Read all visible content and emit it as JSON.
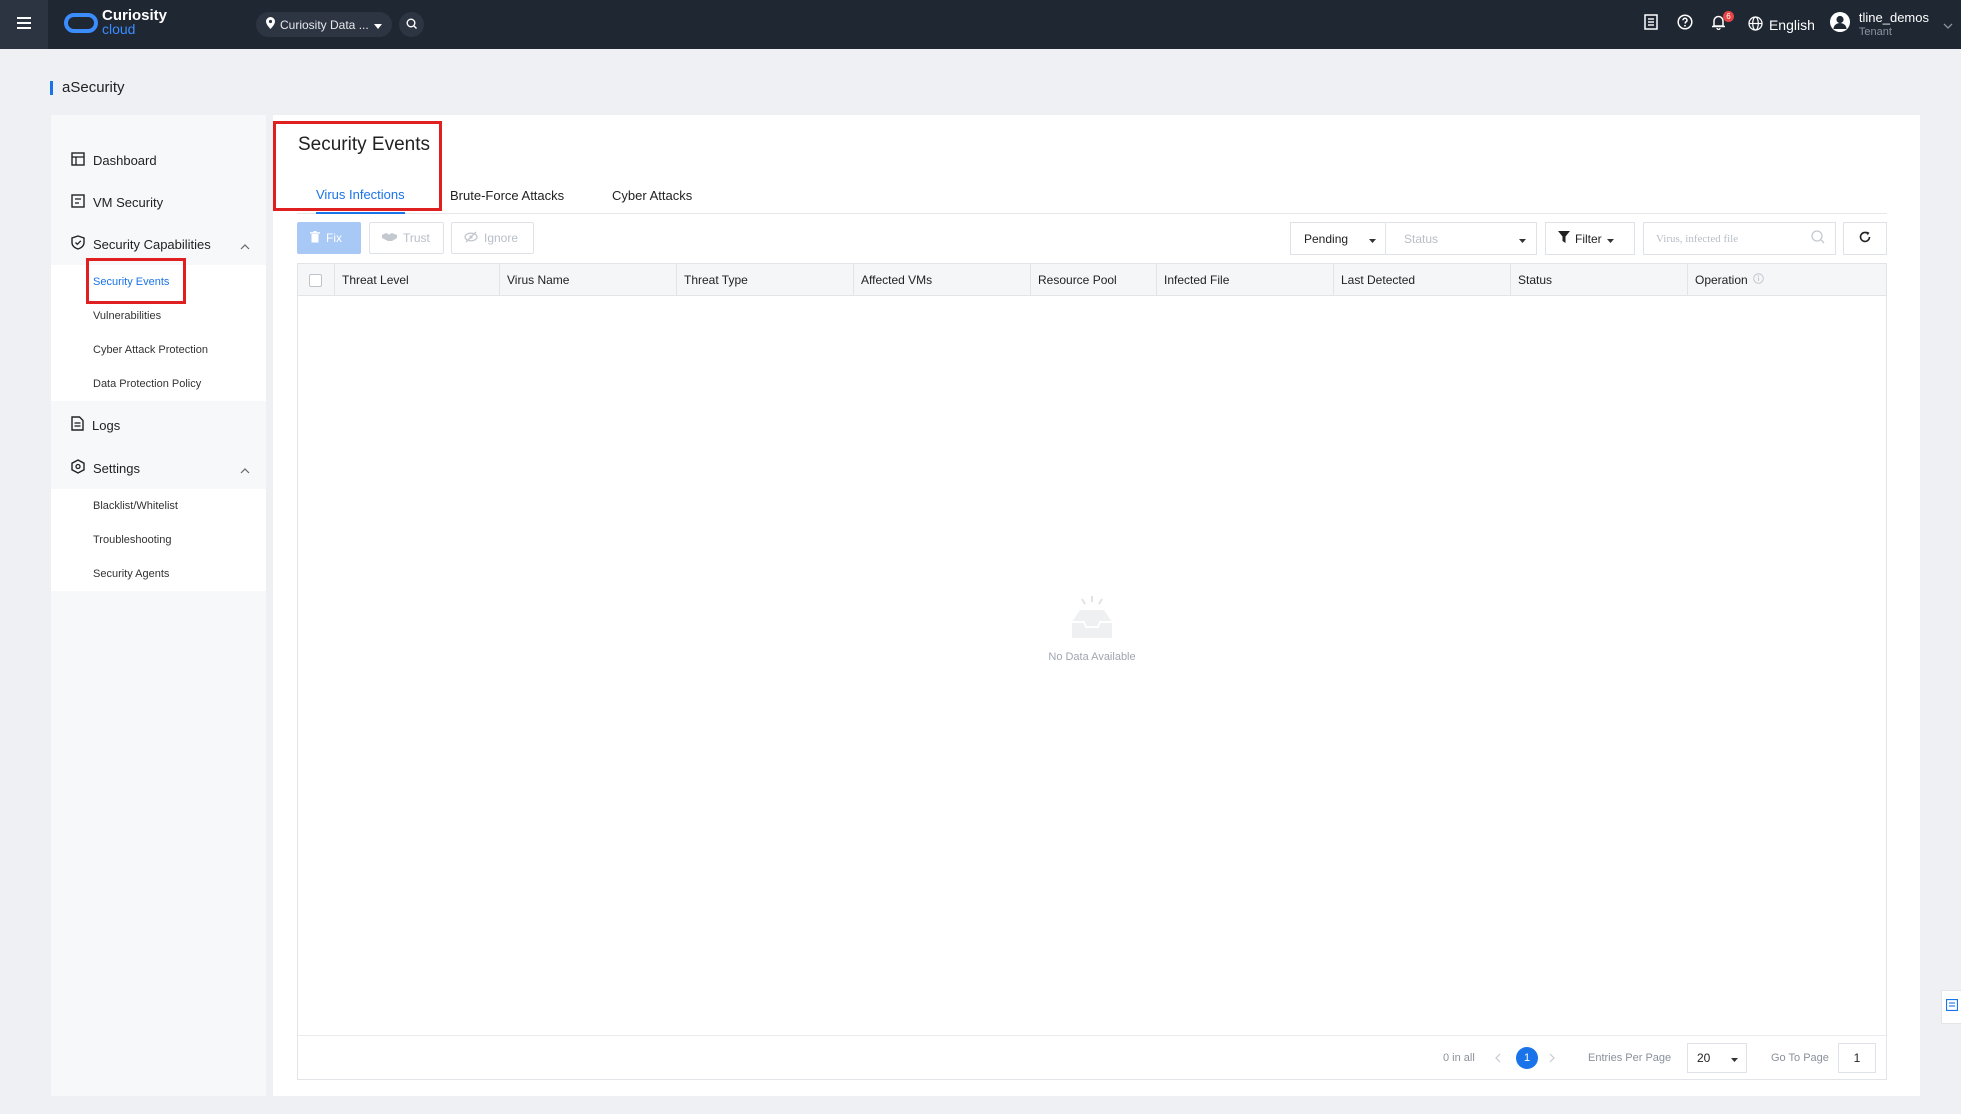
{
  "topbar": {
    "logo_line1": "Curiosity",
    "logo_line2": "cloud",
    "region_label": "Curiosity Data ...",
    "language": "English",
    "notification_count": "6",
    "username": "tline_demos",
    "role": "Tenant",
    "brand_color": "#1a73e8"
  },
  "page": {
    "heading": "aSecurity"
  },
  "sidebar": {
    "items": [
      {
        "label": "Dashboard",
        "icon": "dashboard-icon"
      },
      {
        "label": "VM Security",
        "icon": "vm-icon"
      },
      {
        "label": "Security Capabilities",
        "icon": "shield-icon"
      },
      {
        "label": "Logs",
        "icon": "document-icon"
      },
      {
        "label": "Settings",
        "icon": "settings-icon"
      }
    ],
    "security_sub": [
      "Security Events",
      "Vulnerabilities",
      "Cyber Attack Protection",
      "Data Protection Policy"
    ],
    "settings_sub": [
      "Blacklist/Whitelist",
      "Troubleshooting",
      "Security Agents"
    ]
  },
  "main": {
    "title": "Security Events",
    "tabs": [
      "Virus Infections",
      "Brute-Force Attacks",
      "Cyber Attacks"
    ],
    "active_tab": "Virus Infections",
    "actions": {
      "fix": "Fix",
      "trust": "Trust",
      "ignore": "Ignore"
    },
    "filters": {
      "state_value": "Pending",
      "status_placeholder": "Status",
      "filter_label": "Filter",
      "search_placeholder": "Virus, infected file"
    },
    "columns": [
      "Threat Level",
      "Virus Name",
      "Threat Type",
      "Affected VMs",
      "Resource Pool",
      "Infected File",
      "Last Detected",
      "Status",
      "Operation"
    ],
    "rows": [],
    "empty_text": "No Data Available",
    "pagination": {
      "total": "0 in all",
      "current_page": "1",
      "entries_label": "Entries Per Page",
      "entries_value": "20",
      "goto_label": "Go To Page",
      "goto_value": "1"
    }
  }
}
